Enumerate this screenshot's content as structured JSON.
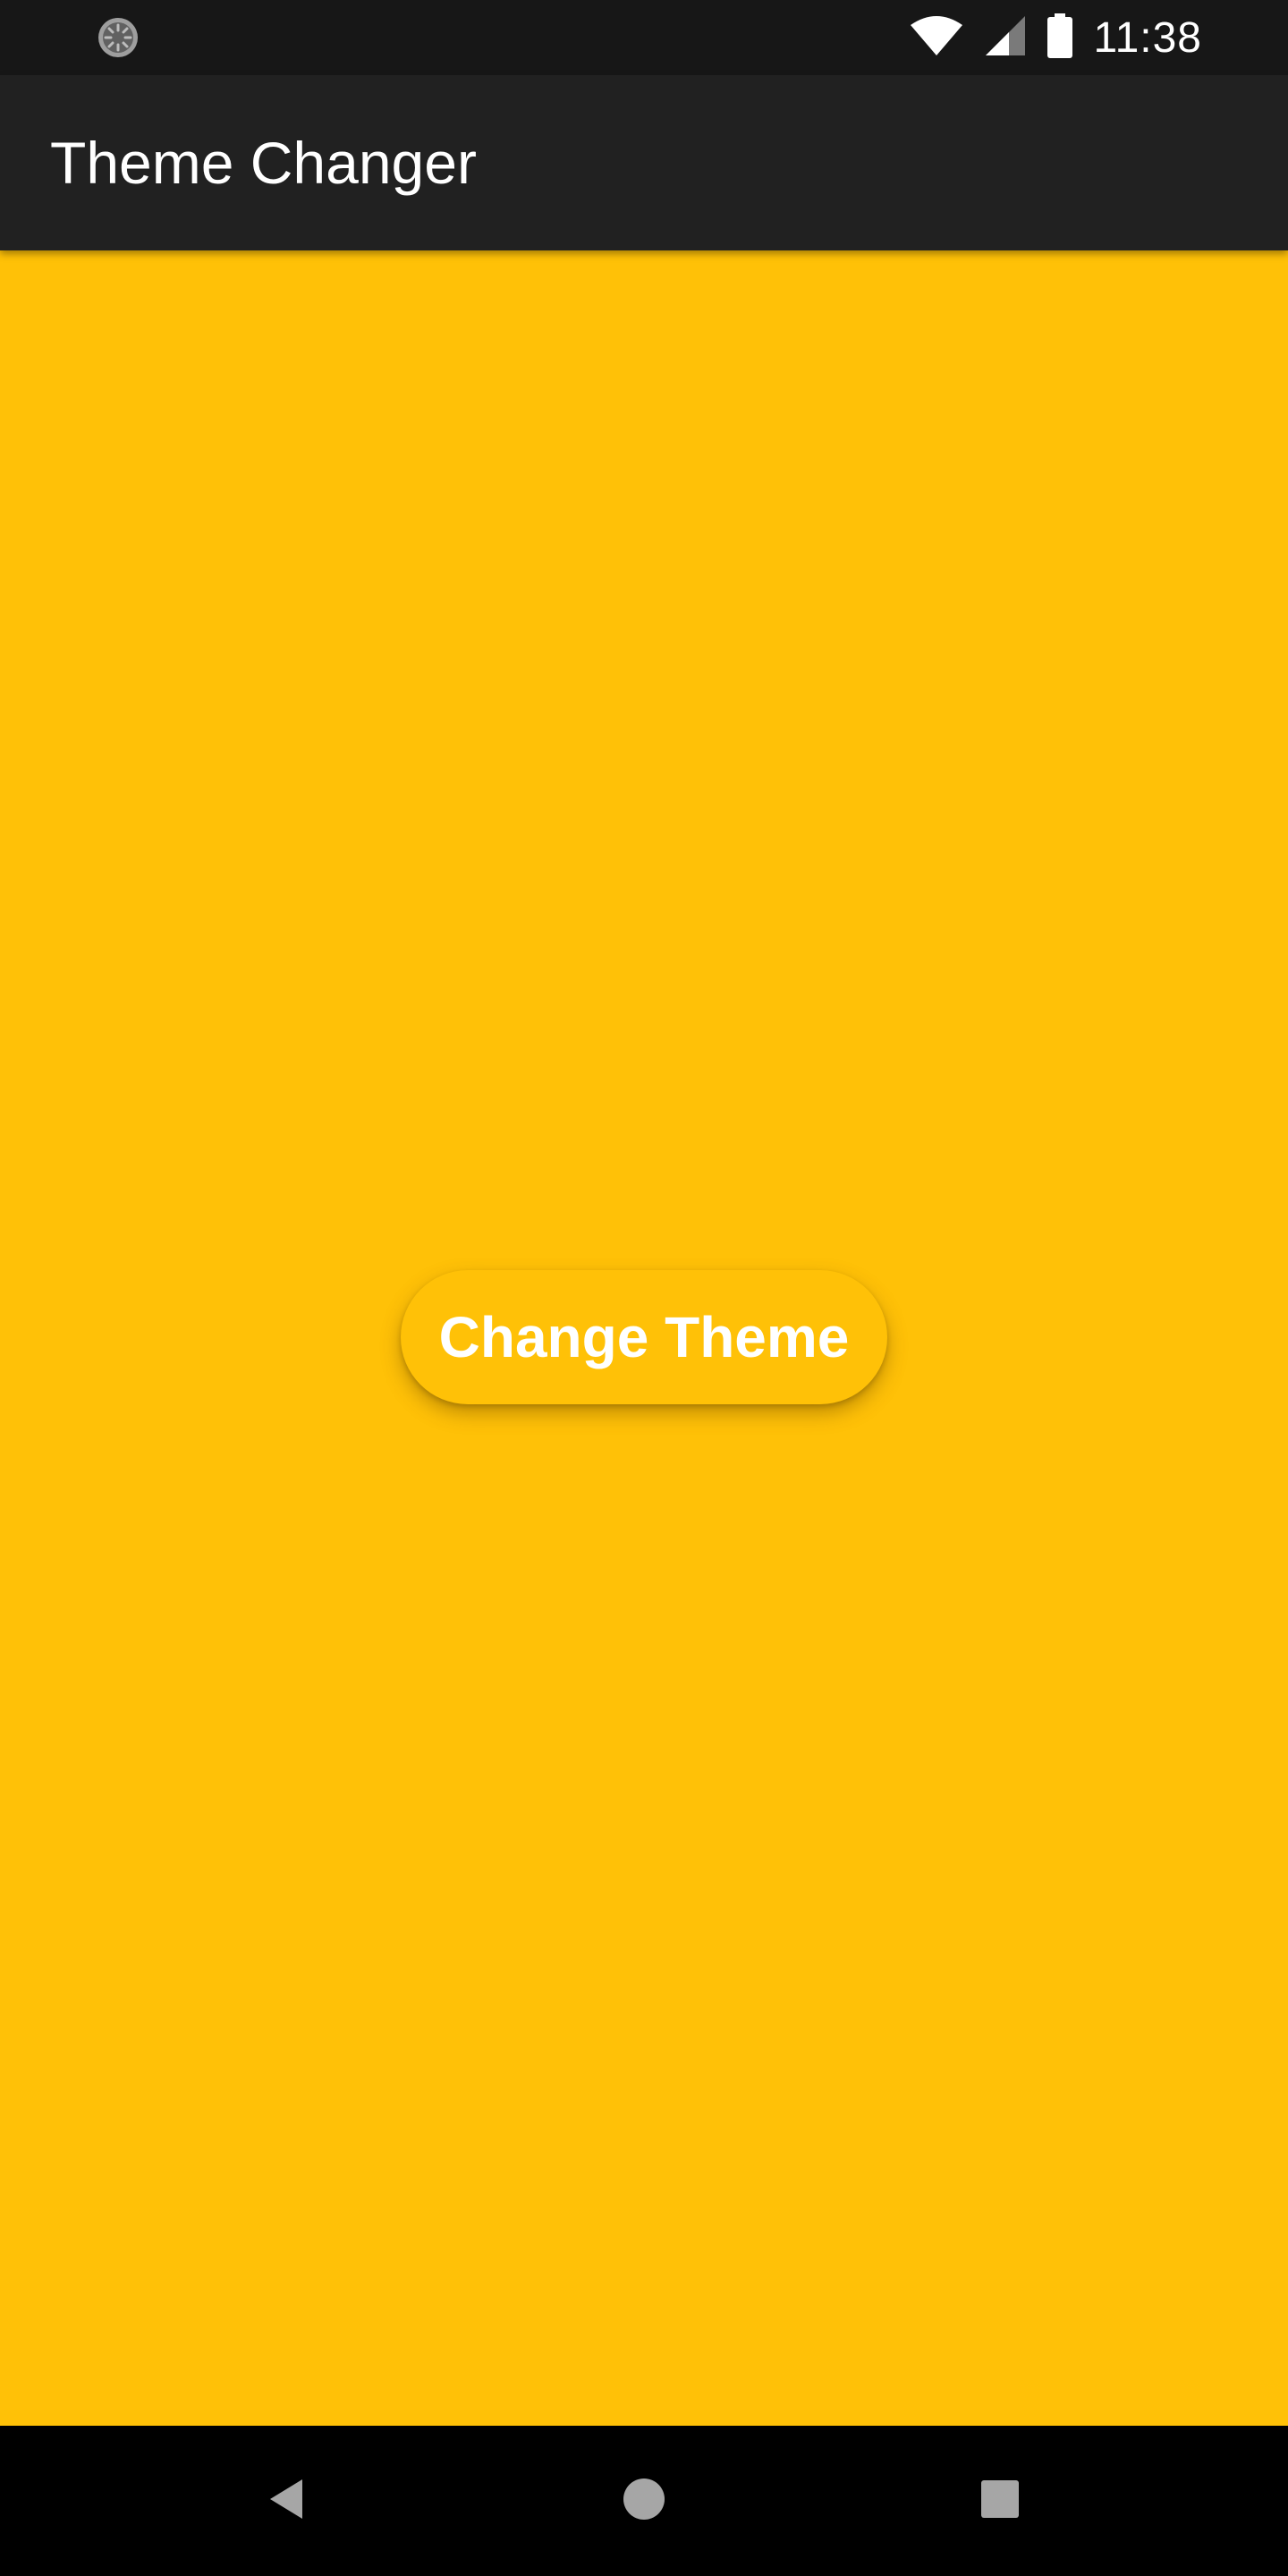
{
  "status_bar": {
    "time": "11:38",
    "left_icon": "sync-loading-icon",
    "icons": [
      "wifi-icon",
      "cellular-signal-icon",
      "battery-icon"
    ]
  },
  "app_bar": {
    "title": "Theme Changer",
    "background_color": "#212121"
  },
  "main": {
    "background_color": "#FFC107",
    "button_label": "Change Theme"
  },
  "nav_bar": {
    "buttons": [
      "back-icon",
      "home-icon",
      "recents-icon"
    ]
  }
}
